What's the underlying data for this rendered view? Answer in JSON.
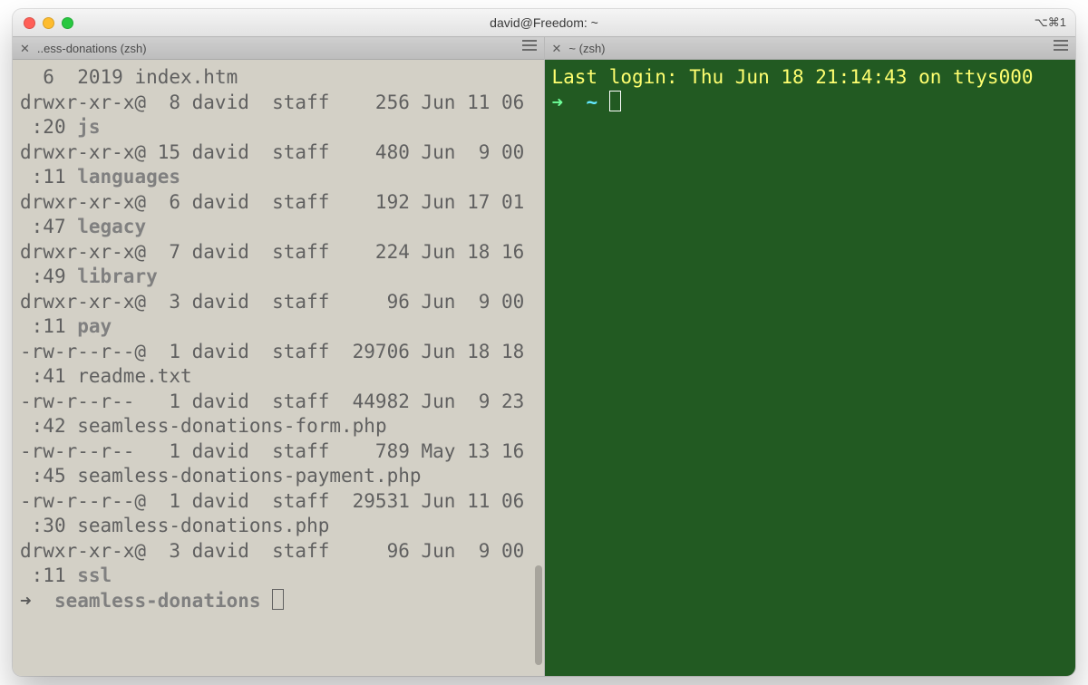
{
  "window": {
    "title": "david@Freedom: ~",
    "right_indicator": "⌥⌘1"
  },
  "tabs": {
    "left": {
      "title": "..ess-donations (zsh)"
    },
    "right": {
      "title": "~ (zsh)"
    }
  },
  "left_pane": {
    "entries": [
      {
        "perm": "",
        "at": "",
        "links": "6",
        "user": "2019",
        "group": "",
        "size": "",
        "month": "",
        "day": "",
        "time": "",
        "name": "index.htm",
        "is_dir": false,
        "prefix_cont": true
      },
      {
        "perm": "drwxr-xr-x",
        "at": "@",
        "links": "8",
        "user": "david",
        "group": "staff",
        "size": "256",
        "month": "Jun",
        "day": "11",
        "time": "06:20",
        "name": "js",
        "is_dir": true
      },
      {
        "perm": "drwxr-xr-x",
        "at": "@",
        "links": "15",
        "user": "david",
        "group": "staff",
        "size": "480",
        "month": "Jun",
        "day": "9",
        "time": "00:11",
        "name": "languages",
        "is_dir": true
      },
      {
        "perm": "drwxr-xr-x",
        "at": "@",
        "links": "6",
        "user": "david",
        "group": "staff",
        "size": "192",
        "month": "Jun",
        "day": "17",
        "time": "01:47",
        "name": "legacy",
        "is_dir": true
      },
      {
        "perm": "drwxr-xr-x",
        "at": "@",
        "links": "7",
        "user": "david",
        "group": "staff",
        "size": "224",
        "month": "Jun",
        "day": "18",
        "time": "16:49",
        "name": "library",
        "is_dir": true
      },
      {
        "perm": "drwxr-xr-x",
        "at": "@",
        "links": "3",
        "user": "david",
        "group": "staff",
        "size": "96",
        "month": "Jun",
        "day": "9",
        "time": "00:11",
        "name": "pay",
        "is_dir": true
      },
      {
        "perm": "-rw-r--r--",
        "at": "@",
        "links": "1",
        "user": "david",
        "group": "staff",
        "size": "29706",
        "month": "Jun",
        "day": "18",
        "time": "18:41",
        "name": "readme.txt",
        "is_dir": false
      },
      {
        "perm": "-rw-r--r--",
        "at": "",
        "links": "1",
        "user": "david",
        "group": "staff",
        "size": "44982",
        "month": "Jun",
        "day": "9",
        "time": "23:42",
        "name": "seamless-donations-form.php",
        "is_dir": false
      },
      {
        "perm": "-rw-r--r--",
        "at": "",
        "links": "1",
        "user": "david",
        "group": "staff",
        "size": "789",
        "month": "May",
        "day": "13",
        "time": "16:45",
        "name": "seamless-donations-payment.php",
        "is_dir": false
      },
      {
        "perm": "-rw-r--r--",
        "at": "@",
        "links": "1",
        "user": "david",
        "group": "staff",
        "size": "29531",
        "month": "Jun",
        "day": "11",
        "time": "06:30",
        "name": "seamless-donations.php",
        "is_dir": false
      },
      {
        "perm": "drwxr-xr-x",
        "at": "@",
        "links": "3",
        "user": "david",
        "group": "staff",
        "size": "96",
        "month": "Jun",
        "day": "9",
        "time": "00:11",
        "name": "ssl",
        "is_dir": true
      }
    ],
    "prompt": {
      "arrow": "➜",
      "dir": "seamless-donations"
    },
    "columns": 44
  },
  "right_pane": {
    "login_line": "Last login: Thu Jun 18 21:14:43 on ttys000",
    "prompt": {
      "arrow": "➜",
      "tilde": "~"
    }
  }
}
